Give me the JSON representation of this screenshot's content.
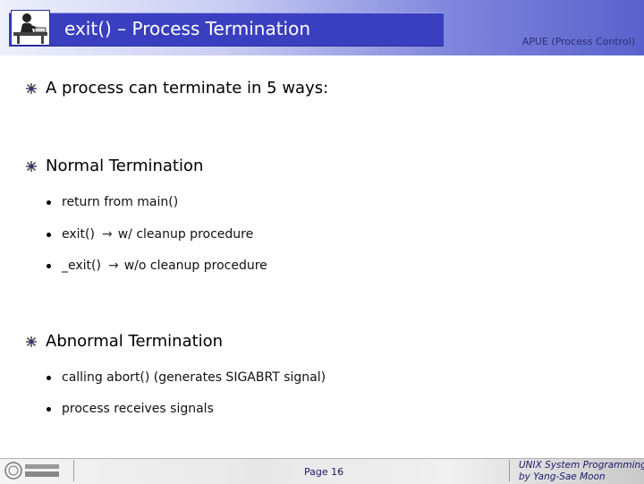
{
  "header": {
    "title": "exit() – Process Termination",
    "reference": "APUE (Process Control)",
    "logo_icon": "teacher-at-desk-icon"
  },
  "content": {
    "intro": "A process can terminate in 5 ways:",
    "sections": [
      {
        "heading": "Normal Termination",
        "items": [
          {
            "text": "return from main()"
          },
          {
            "text": "exit()",
            "arrow": "→",
            "note": "w/ cleanup procedure"
          },
          {
            "text": "_exit()",
            "arrow": "→",
            "note": "w/o cleanup procedure"
          }
        ]
      },
      {
        "heading": "Abnormal Termination",
        "items": [
          {
            "text": "calling abort() (generates SIGABRT signal)"
          },
          {
            "text": "process receives signals"
          }
        ]
      }
    ]
  },
  "footer": {
    "page": "Page 16",
    "course_line1": "UNIX System Programming",
    "course_line2": "by Yang-Sae Moon",
    "university_logo": "university-seal-logo"
  },
  "colors": {
    "title_bar": "#3a3fc0",
    "header_gradient_end": "#5a61cc",
    "footer_text": "#1a1a6a"
  }
}
